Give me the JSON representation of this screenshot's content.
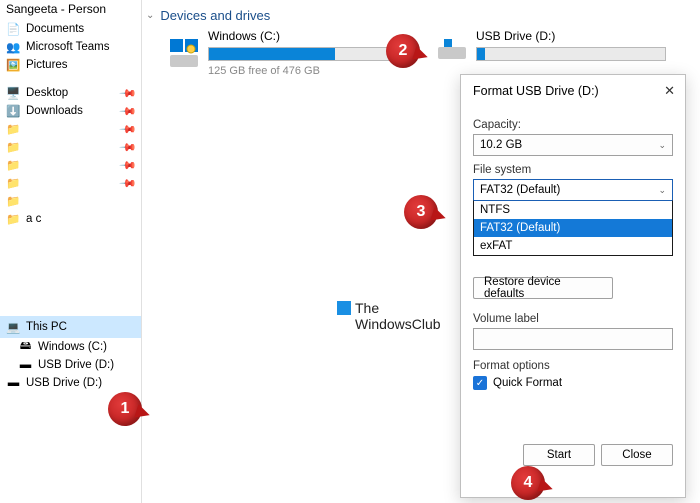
{
  "sidebar": {
    "title": "Sangeeta - Person",
    "quick": [
      {
        "label": "Documents",
        "icon": "doc"
      },
      {
        "label": "Microsoft Teams",
        "icon": "teams"
      },
      {
        "label": "Pictures",
        "icon": "pic"
      }
    ],
    "pinned": [
      {
        "label": "Desktop",
        "icon": "desktop"
      },
      {
        "label": "Downloads",
        "icon": "downloads"
      },
      {
        "label": "",
        "icon": "folder"
      },
      {
        "label": "",
        "icon": "folder"
      },
      {
        "label": "",
        "icon": "folder"
      },
      {
        "label": "",
        "icon": "folder"
      },
      {
        "label": "",
        "icon": "folder"
      },
      {
        "label": "a c",
        "icon": "folder"
      }
    ],
    "thispc": {
      "label": "This PC"
    },
    "drives": [
      {
        "label": "Windows (C:)",
        "icon": "drive"
      },
      {
        "label": "USB Drive (D:)",
        "icon": "usb"
      },
      {
        "label": "USB Drive (D:)",
        "icon": "usb"
      }
    ]
  },
  "main": {
    "section": "Devices and drives",
    "drives": [
      {
        "name": "Windows (C:)",
        "free": "125 GB free of 476 GB",
        "fill": 67
      },
      {
        "name": "USB Drive (D:)",
        "free": "",
        "fill": 4
      }
    ]
  },
  "watermark": {
    "l1": "The",
    "l2": "WindowsClub"
  },
  "dialog": {
    "title": "Format USB Drive (D:)",
    "capacity_lbl": "Capacity:",
    "capacity_val": "10.2 GB",
    "fs_lbl": "File system",
    "fs_val": "FAT32 (Default)",
    "fs_options": [
      "NTFS",
      "FAT32 (Default)",
      "exFAT"
    ],
    "restore": "Restore device defaults",
    "vol_lbl": "Volume label",
    "vol_val": "",
    "opts_lbl": "Format options",
    "quick": "Quick Format",
    "start": "Start",
    "close": "Close"
  },
  "bubbles": {
    "1": "1",
    "2": "2",
    "3": "3",
    "4": "4"
  }
}
